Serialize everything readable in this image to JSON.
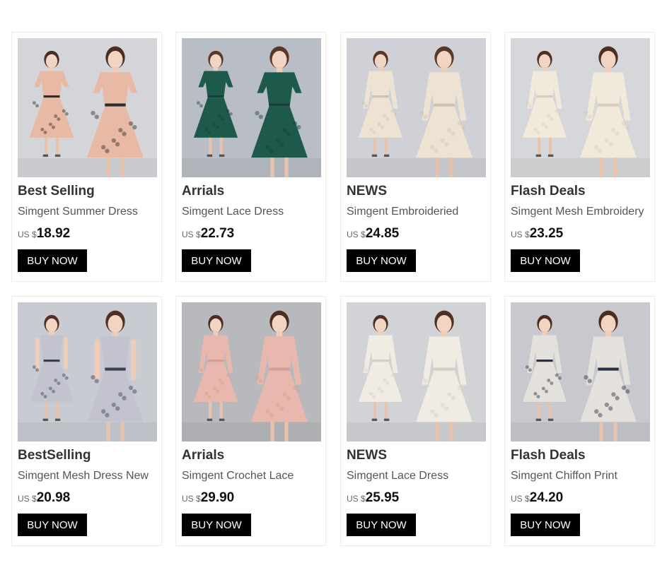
{
  "products": [
    {
      "category": "Best Selling",
      "title": "Simgent Summer Dress",
      "currency": "US $",
      "price": "18.92",
      "button": "BUY NOW",
      "photo": {
        "bg": "#d4d5d9",
        "dress": "#e8b9a4",
        "accent": "#2d2d2d",
        "hair": "#4a2e22",
        "sleeve": "short"
      }
    },
    {
      "category": "Arrials",
      "title": "Simgent Lace Dress",
      "currency": "US $",
      "price": "22.73",
      "button": "BUY NOW",
      "photo": {
        "bg": "#b9bec6",
        "dress": "#1e5a4c",
        "accent": "#154238",
        "hair": "#5a3626",
        "sleeve": "short"
      }
    },
    {
      "category": "NEWS",
      "title": "Simgent Embroideried",
      "currency": "US $",
      "price": "24.85",
      "button": "BUY NOW",
      "photo": {
        "bg": "#cfd1d6",
        "dress": "#eee3d3",
        "accent": "#cfc3b0",
        "hair": "#5a3828",
        "sleeve": "long"
      }
    },
    {
      "category": "Flash Deals",
      "title": "Simgent Mesh Embroidery",
      "currency": "US $",
      "price": "23.25",
      "button": "BUY NOW",
      "photo": {
        "bg": "#d6d7da",
        "dress": "#f1e9da",
        "accent": "#d8cdb8",
        "hair": "#4d3022",
        "sleeve": "long"
      }
    },
    {
      "category": "BestSelling",
      "title": "Simgent Mesh Dress New",
      "currency": "US $",
      "price": "20.98",
      "button": "BUY NOW",
      "photo": {
        "bg": "#c9cbd2",
        "dress": "#c2c3cf",
        "accent": "#3d3f55",
        "hair": "#4e3024",
        "sleeve": "none"
      }
    },
    {
      "category": "Arrials",
      "title": "Simgent Crochet Lace",
      "currency": "US $",
      "price": "29.90",
      "button": "BUY NOW",
      "photo": {
        "bg": "#b8b9bd",
        "dress": "#e8b7ad",
        "accent": "#d49f95",
        "hair": "#4a2d20",
        "sleeve": "long"
      }
    },
    {
      "category": "NEWS",
      "title": "Simgent Lace Dress",
      "currency": "US $",
      "price": "25.95",
      "button": "BUY NOW",
      "photo": {
        "bg": "#d2d3d7",
        "dress": "#f0ebe3",
        "accent": "#d6cfc3",
        "hair": "#4e3024",
        "sleeve": "long"
      }
    },
    {
      "category": "Flash Deals",
      "title": "Simgent Chiffon Print",
      "currency": "US $",
      "price": "24.20",
      "button": "BUY NOW",
      "photo": {
        "bg": "#c7c9ce",
        "dress": "#e4e1dc",
        "accent": "#2b2f45",
        "hair": "#4a2d22",
        "sleeve": "long"
      }
    }
  ]
}
